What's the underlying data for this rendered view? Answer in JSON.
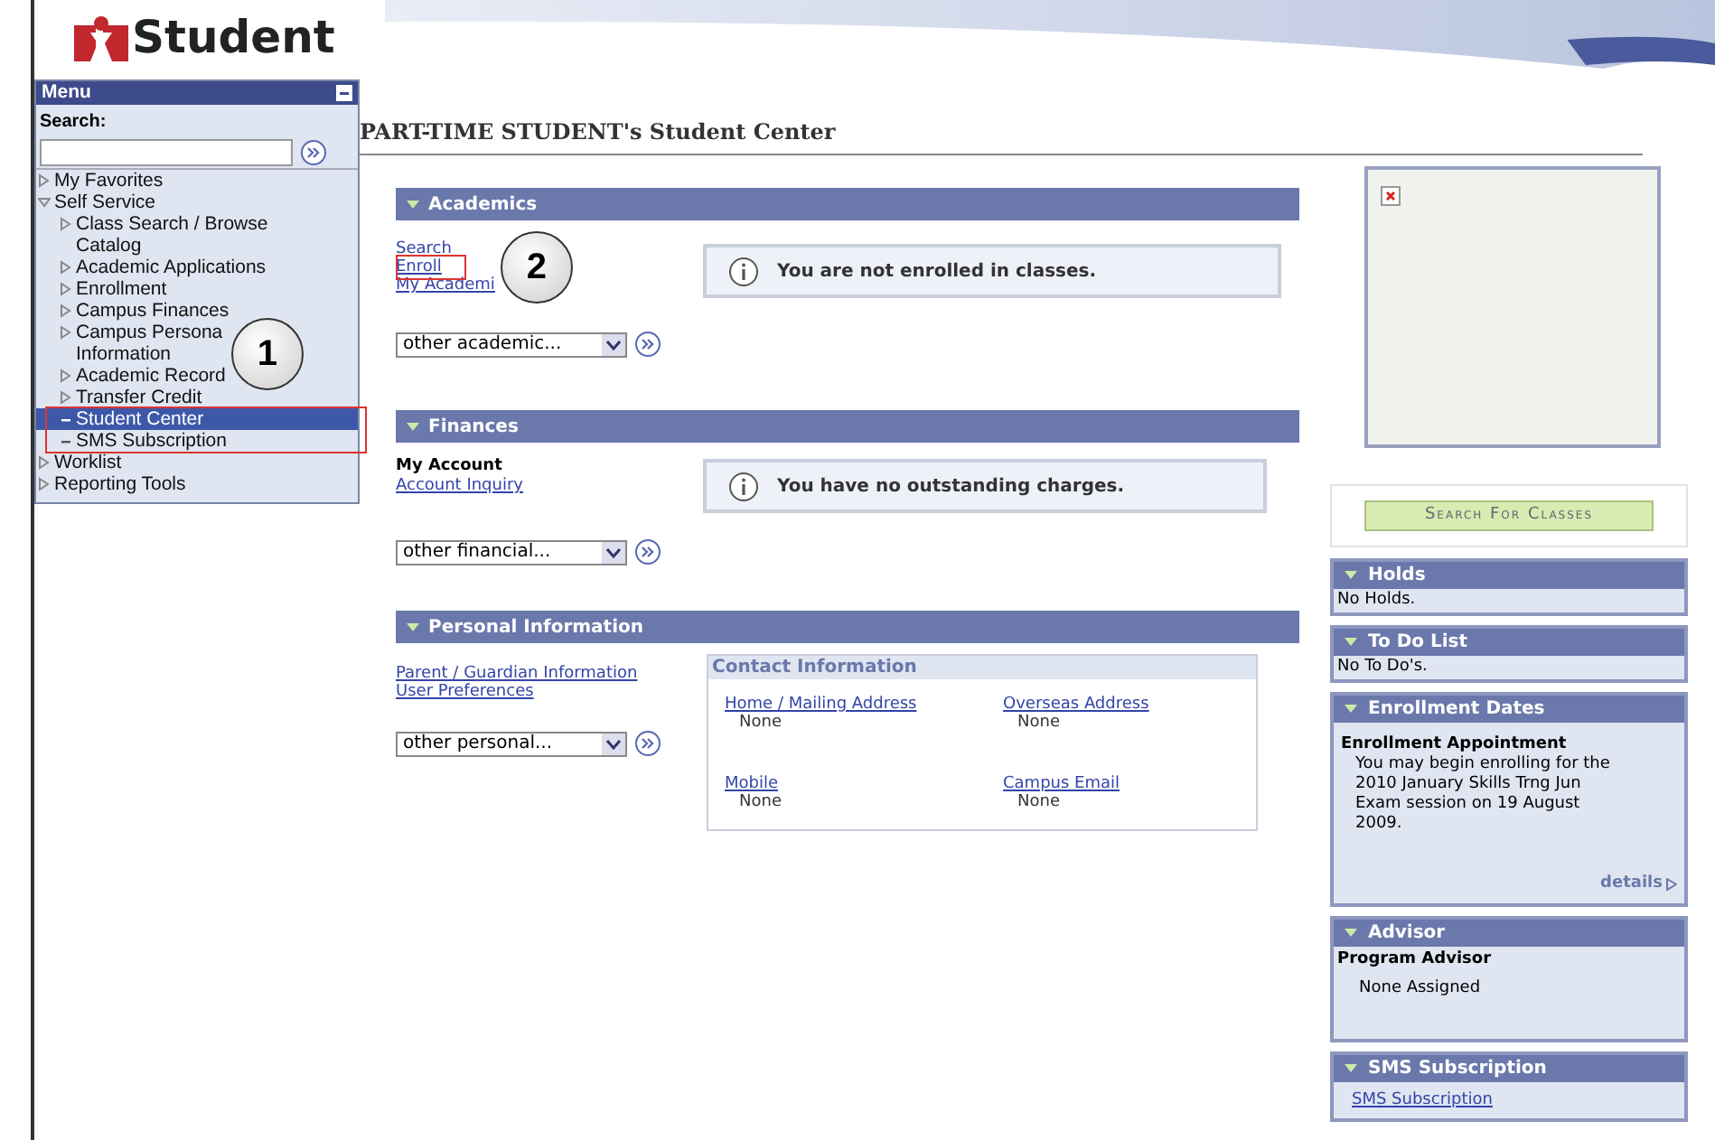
{
  "logo": {
    "text": "Student"
  },
  "menu": {
    "title": "Menu",
    "search_label": "Search:",
    "items": [
      {
        "label": "My Favorites",
        "expanded": false,
        "selected": false
      },
      {
        "label": "Self Service",
        "expanded": true,
        "selected": false,
        "children": [
          {
            "label": "Class Search / Browse Catalog",
            "kind": "folder",
            "selected": false
          },
          {
            "label": "Academic Applications",
            "kind": "folder",
            "selected": false
          },
          {
            "label": "Enrollment",
            "kind": "folder",
            "selected": false
          },
          {
            "label": "Campus Finances",
            "kind": "folder",
            "selected": false
          },
          {
            "label": "Campus Persona",
            "kind": "folder",
            "selected": false
          },
          {
            "label": "Information",
            "kind": "continuation",
            "selected": false
          },
          {
            "label": "Academic Record",
            "kind": "folder",
            "selected": false
          },
          {
            "label": "Transfer Credit",
            "kind": "folder",
            "selected": false
          },
          {
            "label": "Student Center",
            "kind": "leaf",
            "selected": true
          },
          {
            "label": "SMS Subscription",
            "kind": "leaf",
            "selected": false
          }
        ]
      },
      {
        "label": "Worklist",
        "expanded": false,
        "selected": false
      },
      {
        "label": "Reporting Tools",
        "expanded": false,
        "selected": false
      }
    ]
  },
  "page_title": "PART-TIME STUDENT's Student Center",
  "academics": {
    "title": "Academics",
    "links": [
      "Search",
      "Enroll",
      "My Academi"
    ],
    "dropdown": "other academic...",
    "message": "You are not enrolled in classes."
  },
  "finances": {
    "title": "Finances",
    "heading": "My Account",
    "links": [
      "Account Inquiry"
    ],
    "dropdown": "other financial...",
    "message": "You have no outstanding charges."
  },
  "personal": {
    "title": "Personal Information",
    "links": [
      "Parent / Guardian Information",
      "User Preferences"
    ],
    "dropdown": "other personal...",
    "contact_title": "Contact Information",
    "contacts": [
      {
        "label": "Home / Mailing Address",
        "value": "None"
      },
      {
        "label": "Overseas Address",
        "value": "None"
      },
      {
        "label": "Mobile",
        "value": "None"
      },
      {
        "label": "Campus Email",
        "value": "None"
      }
    ]
  },
  "search_classes_button": "Search For Classes",
  "side_panels": [
    {
      "kind": "text",
      "title": "Holds",
      "body": "No Holds."
    },
    {
      "kind": "text",
      "title": "To Do List",
      "body": "No To Do's."
    },
    {
      "kind": "enrollment",
      "title": "Enrollment Dates",
      "heading": "Enrollment Appointment",
      "body": "You may begin enrolling for the 2010 January Skills Trng Jun Exam session on 19 August 2009.",
      "link": "details"
    },
    {
      "kind": "advisor",
      "title": "Advisor",
      "heading": "Program Advisor",
      "body": "None Assigned"
    },
    {
      "kind": "link",
      "title": "SMS Subscription",
      "body": "SMS Subscription"
    }
  ],
  "callouts": [
    {
      "number": "1"
    },
    {
      "number": "2"
    }
  ]
}
